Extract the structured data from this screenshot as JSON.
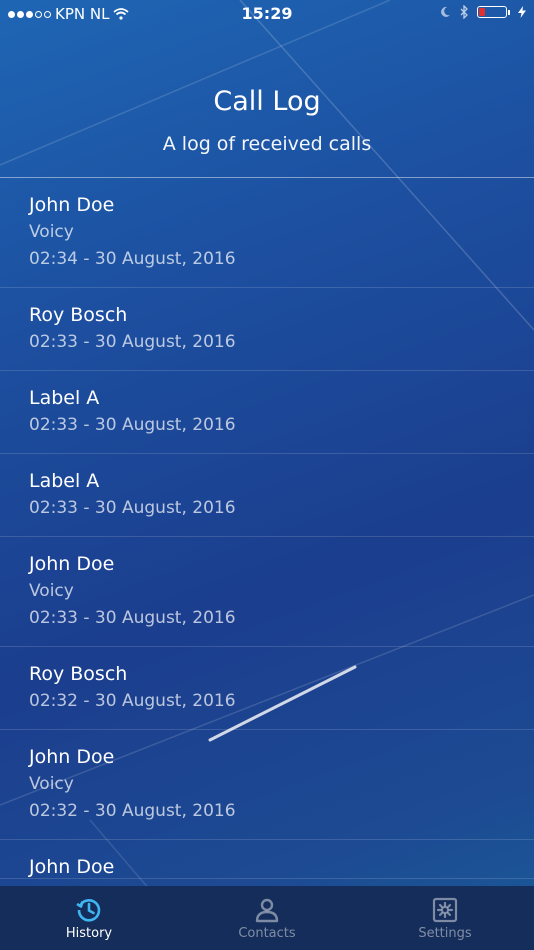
{
  "status_bar": {
    "carrier": "KPN NL",
    "time": "15:29",
    "signal_bars_filled": 3,
    "signal_bars_total": 5
  },
  "header": {
    "title": "Call Log",
    "subtitle": "A log of received calls"
  },
  "calls": [
    {
      "name": "John Doe",
      "label": "Voicy",
      "time": "02:34 - 30 August, 2016"
    },
    {
      "name": "Roy Bosch",
      "label": "",
      "time": "02:33 - 30 August, 2016"
    },
    {
      "name": "Label A",
      "label": "",
      "time": "02:33 - 30 August, 2016"
    },
    {
      "name": "Label A",
      "label": "",
      "time": "02:33 - 30 August, 2016"
    },
    {
      "name": "John Doe",
      "label": "Voicy",
      "time": "02:33 - 30 August, 2016"
    },
    {
      "name": "Roy Bosch",
      "label": "",
      "time": "02:32 - 30 August, 2016"
    },
    {
      "name": "John Doe",
      "label": "Voicy",
      "time": "02:32 - 30 August, 2016"
    },
    {
      "name": "John Doe",
      "label": "",
      "time": ""
    }
  ],
  "tabs": [
    {
      "label": "History",
      "icon": "history-icon",
      "active": true
    },
    {
      "label": "Contacts",
      "icon": "person-icon",
      "active": false
    },
    {
      "label": "Settings",
      "icon": "gear-icon",
      "active": false
    }
  ],
  "colors": {
    "accent": "#3fb6ef",
    "tabbar": "#152d5a",
    "battery_low": "#e03030"
  }
}
